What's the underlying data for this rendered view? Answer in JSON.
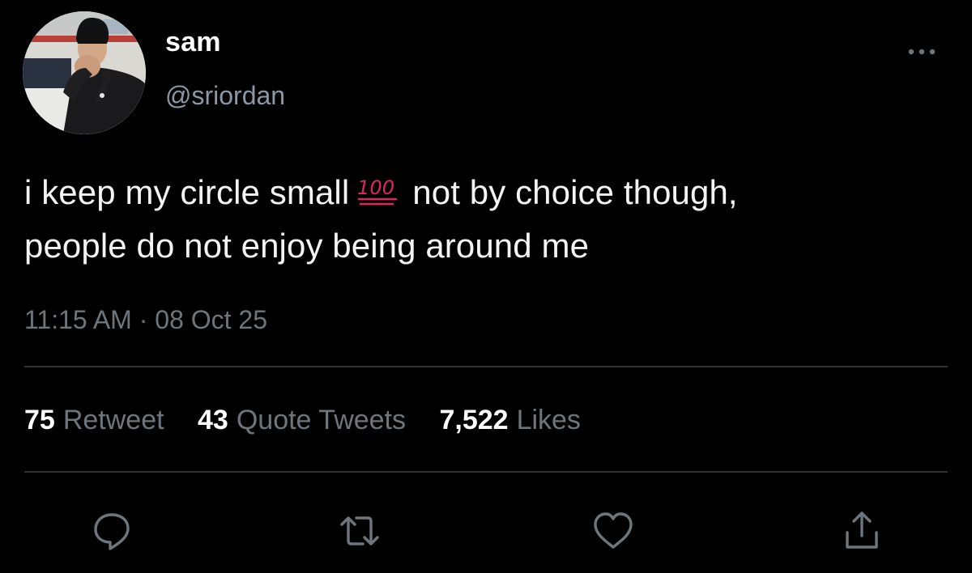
{
  "user": {
    "display_name": "sam",
    "handle": "@sriordan"
  },
  "tweet": {
    "text_line1_before": "i keep my circle small",
    "emoji": "💯",
    "text_line1_after": "not by choice though,",
    "text_line2": "people do not enjoy being around me",
    "time": "11:15 AM",
    "separator": "·",
    "date": "08 Oct 25"
  },
  "stats": {
    "retweets_count": "75",
    "retweets_label": "Retweet",
    "quotes_count": "43",
    "quotes_label": "Quote Tweets",
    "likes_count": "7,522",
    "likes_label": "Likes"
  },
  "icons": {
    "more": "more-horizontal-icon",
    "reply": "reply-icon",
    "retweet": "retweet-icon",
    "like": "heart-icon",
    "share": "share-icon"
  },
  "colors": {
    "background": "#000000",
    "primary_text": "#ffffff",
    "secondary_text": "#6e767d",
    "divider": "#2f3336",
    "emoji_red": "#e0245e"
  }
}
